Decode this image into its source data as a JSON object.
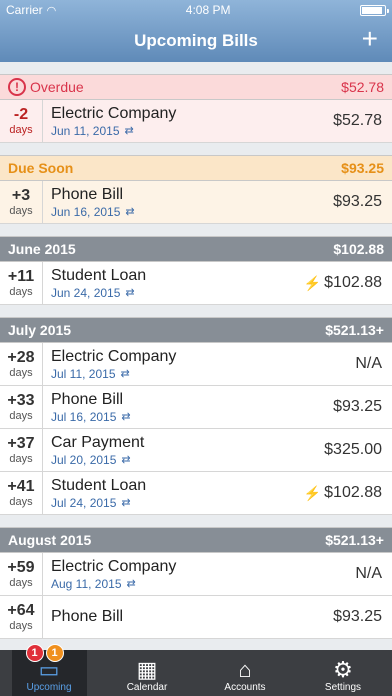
{
  "status": {
    "carrier": "Carrier",
    "time": "4:08 PM"
  },
  "nav": {
    "title": "Upcoming Bills",
    "add_label": "+"
  },
  "sections": {
    "overdue": {
      "title": "Overdue",
      "total": "$52.78",
      "items": [
        {
          "days": "-2",
          "unit": "days",
          "name": "Electric Company",
          "date": "Jun 11, 2015",
          "amount": "$52.78"
        }
      ]
    },
    "soon": {
      "title": "Due Soon",
      "total": "$93.25",
      "items": [
        {
          "days": "+3",
          "unit": "days",
          "name": "Phone Bill",
          "date": "Jun 16, 2015",
          "amount": "$93.25"
        }
      ]
    },
    "june": {
      "title": "June 2015",
      "total": "$102.88",
      "items": [
        {
          "days": "+11",
          "unit": "days",
          "name": "Student Loan",
          "date": "Jun 24, 2015",
          "amount": "$102.88"
        }
      ]
    },
    "july": {
      "title": "July 2015",
      "total": "$521.13+",
      "items": [
        {
          "days": "+28",
          "unit": "days",
          "name": "Electric Company",
          "date": "Jul 11, 2015",
          "amount": "N/A"
        },
        {
          "days": "+33",
          "unit": "days",
          "name": "Phone Bill",
          "date": "Jul 16, 2015",
          "amount": "$93.25"
        },
        {
          "days": "+37",
          "unit": "days",
          "name": "Car Payment",
          "date": "Jul 20, 2015",
          "amount": "$325.00"
        },
        {
          "days": "+41",
          "unit": "days",
          "name": "Student Loan",
          "date": "Jul 24, 2015",
          "amount": "$102.88"
        }
      ]
    },
    "august": {
      "title": "August 2015",
      "total": "$521.13+",
      "items": [
        {
          "days": "+59",
          "unit": "days",
          "name": "Electric Company",
          "date": "Aug 11, 2015",
          "amount": "N/A"
        },
        {
          "days": "+64",
          "unit": "days",
          "name": "Phone Bill",
          "date": "",
          "amount": "$93.25"
        }
      ]
    }
  },
  "tabs": [
    {
      "label": "Upcoming",
      "badge_red": "1",
      "badge_orange": "1"
    },
    {
      "label": "Calendar"
    },
    {
      "label": "Accounts"
    },
    {
      "label": "Settings"
    }
  ],
  "colors": {
    "nav": "#6f98c5",
    "overdue": "#d9344b",
    "soon": "#e69018",
    "month_header": "#878e96",
    "link": "#3a6aa8"
  }
}
